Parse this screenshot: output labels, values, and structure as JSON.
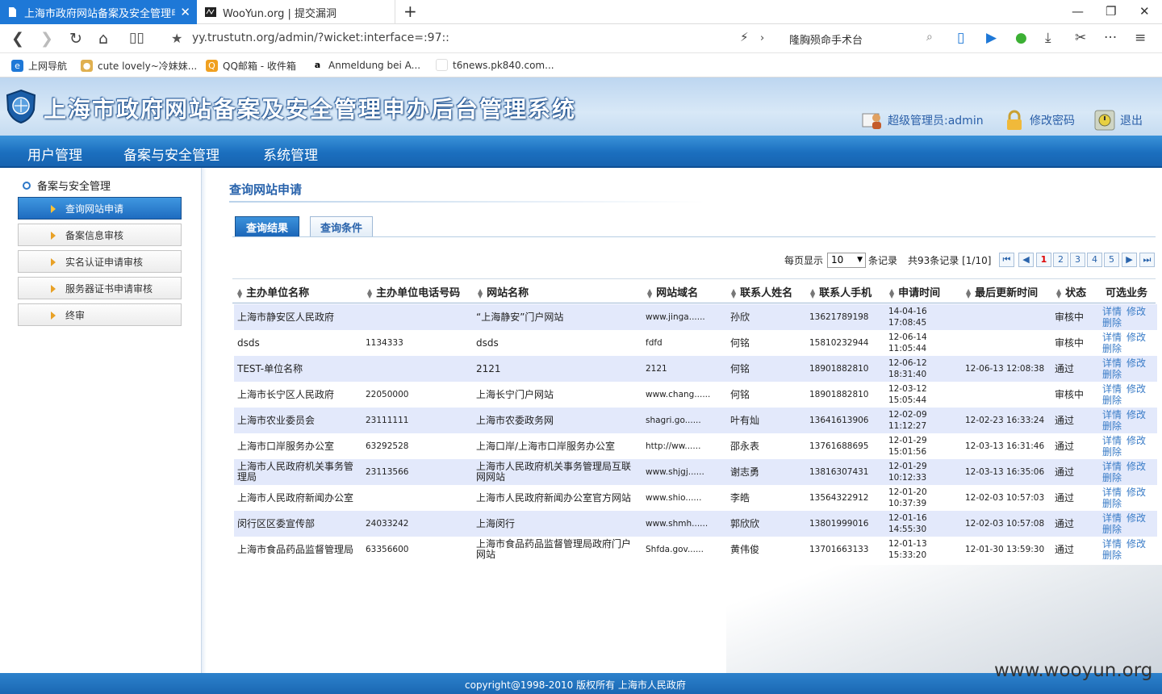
{
  "browser": {
    "tabs": [
      {
        "title": "上海市政府网站备案及安全管理申办",
        "active": true
      },
      {
        "title": "WooYun.org | 提交漏洞",
        "active": false
      }
    ],
    "url": "yy.trustutn.org/admin/?wicket:interface=:97::",
    "search_text": "隆胸殒命手术台",
    "bookmarks": [
      "上网导航",
      "cute lovely~冷妹妹...",
      "QQ邮箱 - 收件箱",
      "Anmeldung bei A...",
      "t6news.pk840.com..."
    ]
  },
  "header": {
    "system_title": "上海市政府网站备案及安全管理申办后台管理系统",
    "user_label": "超级管理员:admin",
    "change_password": "修改密码",
    "logout": "退出"
  },
  "menu": [
    "用户管理",
    "备案与安全管理",
    "系统管理"
  ],
  "sidebar": {
    "heading": "备案与安全管理",
    "items": [
      {
        "label": "查询网站申请",
        "active": true
      },
      {
        "label": "备案信息审核",
        "active": false
      },
      {
        "label": "实名认证申请审核",
        "active": false
      },
      {
        "label": "服务器证书申请审核",
        "active": false
      },
      {
        "label": "终审",
        "active": false
      }
    ]
  },
  "content": {
    "title": "查询网站申请",
    "tabs": [
      "查询结果",
      "查询条件"
    ],
    "pager": {
      "per_page_label": "每页显示",
      "per_page_value": "10",
      "unit": "条记录",
      "total": "共93条记录 [1/10]",
      "pages": [
        "1",
        "2",
        "3",
        "4",
        "5"
      ],
      "first": "⏮",
      "prev": "◀",
      "next": "▶",
      "last": "⏭"
    },
    "columns": [
      "主办单位名称",
      "主办单位电话号码",
      "网站名称",
      "网站域名",
      "联系人姓名",
      "联系人手机",
      "申请时间",
      "最后更新时间",
      "状态",
      "可选业务"
    ],
    "actions": {
      "detail": "详情",
      "edit": "修改",
      "delete": "删除"
    },
    "rows": [
      {
        "unit": "上海市静安区人民政府",
        "phone": "",
        "site": "“上海静安”门户网站",
        "domain": "www.jinga......",
        "contact": "孙欣",
        "mobile": "13621789198",
        "apply_date": "14-04-16",
        "apply_time": "17:08:45",
        "updated": "",
        "status": "审核中"
      },
      {
        "unit": "dsds",
        "phone": "1134333",
        "site": "dsds",
        "domain": "fdfd",
        "contact": "何铭",
        "mobile": "15810232944",
        "apply_date": "12-06-14",
        "apply_time": "11:05:44",
        "updated": "",
        "status": "审核中"
      },
      {
        "unit": "TEST-单位名称",
        "phone": "",
        "site": "2121",
        "domain": "2121",
        "contact": "何铭",
        "mobile": "18901882810",
        "apply_date": "12-06-12",
        "apply_time": "18:31:40",
        "updated": "12-06-13 12:08:38",
        "status": "通过"
      },
      {
        "unit": "上海市长宁区人民政府",
        "phone": "22050000",
        "site": "上海长宁门户网站",
        "domain": "www.chang......",
        "contact": "何铭",
        "mobile": "18901882810",
        "apply_date": "12-03-12",
        "apply_time": "15:05:44",
        "updated": "",
        "status": "审核中"
      },
      {
        "unit": "上海市农业委员会",
        "phone": "23111111",
        "site": "上海市农委政务网",
        "domain": "shagri.go......",
        "contact": "叶有灿",
        "mobile": "13641613906",
        "apply_date": "12-02-09",
        "apply_time": "11:12:27",
        "updated": "12-02-23 16:33:24",
        "status": "通过"
      },
      {
        "unit": "上海市口岸服务办公室",
        "phone": "63292528",
        "site": "上海口岸/上海市口岸服务办公室",
        "domain": "http://ww......",
        "contact": "邵永表",
        "mobile": "13761688695",
        "apply_date": "12-01-29",
        "apply_time": "15:01:56",
        "updated": "12-03-13 16:31:46",
        "status": "通过"
      },
      {
        "unit": "上海市人民政府机关事务管理局",
        "phone": "23113566",
        "site": "上海市人民政府机关事务管理局互联网网站",
        "domain": "www.shjgj......",
        "contact": "谢志勇",
        "mobile": "13816307431",
        "apply_date": "12-01-29",
        "apply_time": "10:12:33",
        "updated": "12-03-13 16:35:06",
        "status": "通过"
      },
      {
        "unit": "上海市人民政府新闻办公室",
        "phone": "",
        "site": "上海市人民政府新闻办公室官方网站",
        "domain": "www.shio......",
        "contact": "李皓",
        "mobile": "13564322912",
        "apply_date": "12-01-20",
        "apply_time": "10:37:39",
        "updated": "12-02-03 10:57:03",
        "status": "通过"
      },
      {
        "unit": "闵行区区委宣传部",
        "phone": "24033242",
        "site": "上海闵行",
        "domain": "www.shmh......",
        "contact": "郭欣欣",
        "mobile": "13801999016",
        "apply_date": "12-01-16",
        "apply_time": "14:55:30",
        "updated": "12-02-03 10:57:08",
        "status": "通过"
      },
      {
        "unit": "上海市食品药品监督管理局",
        "phone": "63356600",
        "site": "上海市食品药品监督管理局政府门户网站",
        "domain": "Shfda.gov......",
        "contact": "黄伟俊",
        "mobile": "13701663133",
        "apply_date": "12-01-13",
        "apply_time": "15:33:20",
        "updated": "12-01-30 13:59:30",
        "status": "通过"
      }
    ]
  },
  "footer": "copyright@1998-2010 版权所有 上海市人民政府",
  "watermark": "www.wooyun.org",
  "colors": {
    "accent": "#1b6fbf",
    "link": "#3a7cc7",
    "row_alt": "#e3e9fb"
  }
}
